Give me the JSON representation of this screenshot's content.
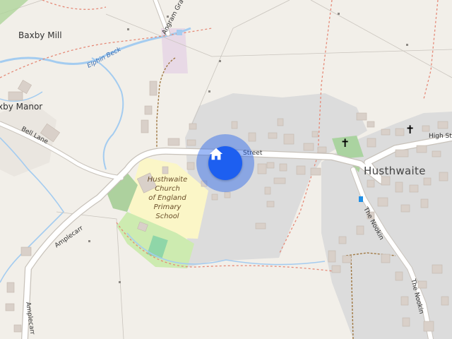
{
  "map": {
    "places": {
      "baxby_mill": "Baxby Mill",
      "baxby_manor": "xby Manor",
      "husthwaite": "Husthwaite"
    },
    "roads": {
      "bell_lane": "Bell Lane",
      "amplecarr_upper": "Amplecarr",
      "amplecarr_lower": "Amplecarr",
      "street": "Street",
      "high_street": "High St",
      "the_nookin_upper": "The Nookin",
      "the_nookin_lower": "The Nookin",
      "angram_grange": "Angram Gra"
    },
    "water": {
      "elphin_beck": "Elphin Beck"
    },
    "school": {
      "line1": "Husthwaite",
      "line2": "Church",
      "line3": "of England",
      "line4": "Primary",
      "line5": "School"
    },
    "marker": {
      "icon": "home-icon",
      "color": "#1d5ff0"
    },
    "colors": {
      "land": "#f2efe9",
      "residential": "#dcdcdc",
      "school_area": "#fbf6c7",
      "park": "#cdebb0",
      "road": "#ffffff",
      "water": "#a4ccf0",
      "building": "#d9d0c9"
    }
  }
}
